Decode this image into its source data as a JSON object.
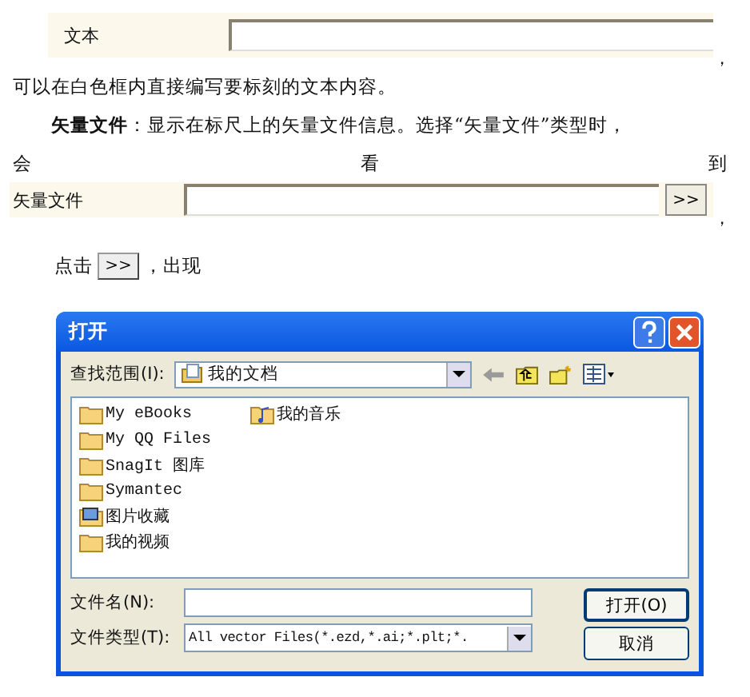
{
  "text_field": {
    "label": "文本",
    "trailing": "，"
  },
  "paragraphs": [
    {
      "kind": "plain",
      "text": "可以在白色框内直接编写要标刻的文本内容。"
    },
    {
      "kind": "indent",
      "text": "**矢量文件**：显示在标尺上的矢量文件信息。选择“矢量文件”类型时，"
    },
    {
      "kind": "spread",
      "text": "会看到"
    }
  ],
  "vector_field": {
    "label": "矢量文件",
    "button": ">>",
    "trailing": "，"
  },
  "click_line": {
    "before": "点击",
    "button": ">>",
    "after": "，出现"
  },
  "dialog": {
    "title": "打开",
    "look_in": {
      "label": "查找范围(I):",
      "value": "我的文档"
    },
    "files": [
      {
        "name": "My eBooks",
        "kind": "folder"
      },
      {
        "name": "My QQ Files",
        "kind": "folder"
      },
      {
        "name": "SnagIt 图库",
        "kind": "folder"
      },
      {
        "name": "Symantec",
        "kind": "folder"
      },
      {
        "name": "图片收藏",
        "kind": "pictures"
      },
      {
        "name": "我的视频",
        "kind": "folder"
      },
      {
        "name": "我的音乐",
        "kind": "music"
      }
    ],
    "file_name": {
      "label": "文件名(N):"
    },
    "file_type": {
      "label": "文件类型(T):",
      "value": "All vector Files(*.ezd,*.ai;*.plt;*."
    },
    "buttons": [
      "打开(O)",
      "取消"
    ]
  }
}
